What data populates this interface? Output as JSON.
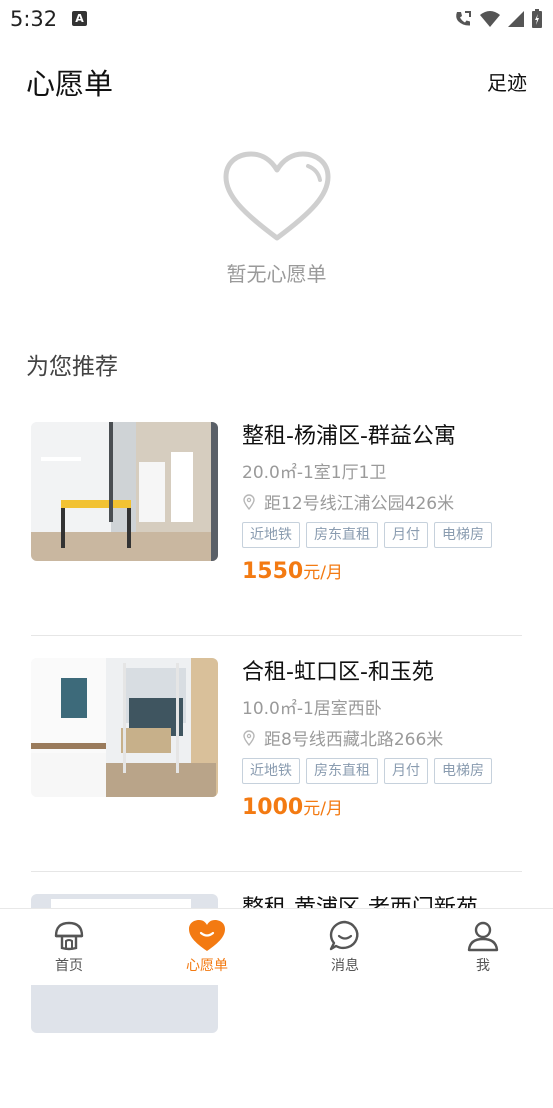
{
  "status": {
    "time": "5:32"
  },
  "header": {
    "title": "心愿单",
    "footprint_label": "足迹"
  },
  "empty": {
    "text": "暂无心愿单"
  },
  "recommend": {
    "title": "为您推荐",
    "items": [
      {
        "title": "整租-杨浦区-群益公寓",
        "spec": "20.0㎡-1室1厅1卫",
        "distance": "距12号线江浦公园426米",
        "tags": [
          "近地铁",
          "房东直租",
          "月付",
          "电梯房"
        ],
        "price": "1550",
        "price_unit": "元/月"
      },
      {
        "title": "合租-虹口区-和玉苑",
        "spec": "10.0㎡-1居室西卧",
        "distance": "距8号线西藏北路266米",
        "tags": [
          "近地铁",
          "房东直租",
          "月付",
          "电梯房"
        ],
        "price": "1000",
        "price_unit": "元/月"
      },
      {
        "title": "整租-黄浦区-老西门新苑"
      }
    ]
  },
  "tabbar": {
    "items": [
      {
        "label": "首页",
        "icon": "home-mushroom-icon",
        "active": false
      },
      {
        "label": "心愿单",
        "icon": "heart-icon",
        "active": true
      },
      {
        "label": "消息",
        "icon": "message-icon",
        "active": false
      },
      {
        "label": "我",
        "icon": "profile-icon",
        "active": false
      }
    ],
    "active_color": "#f37a12",
    "inactive_color": "#555555"
  }
}
